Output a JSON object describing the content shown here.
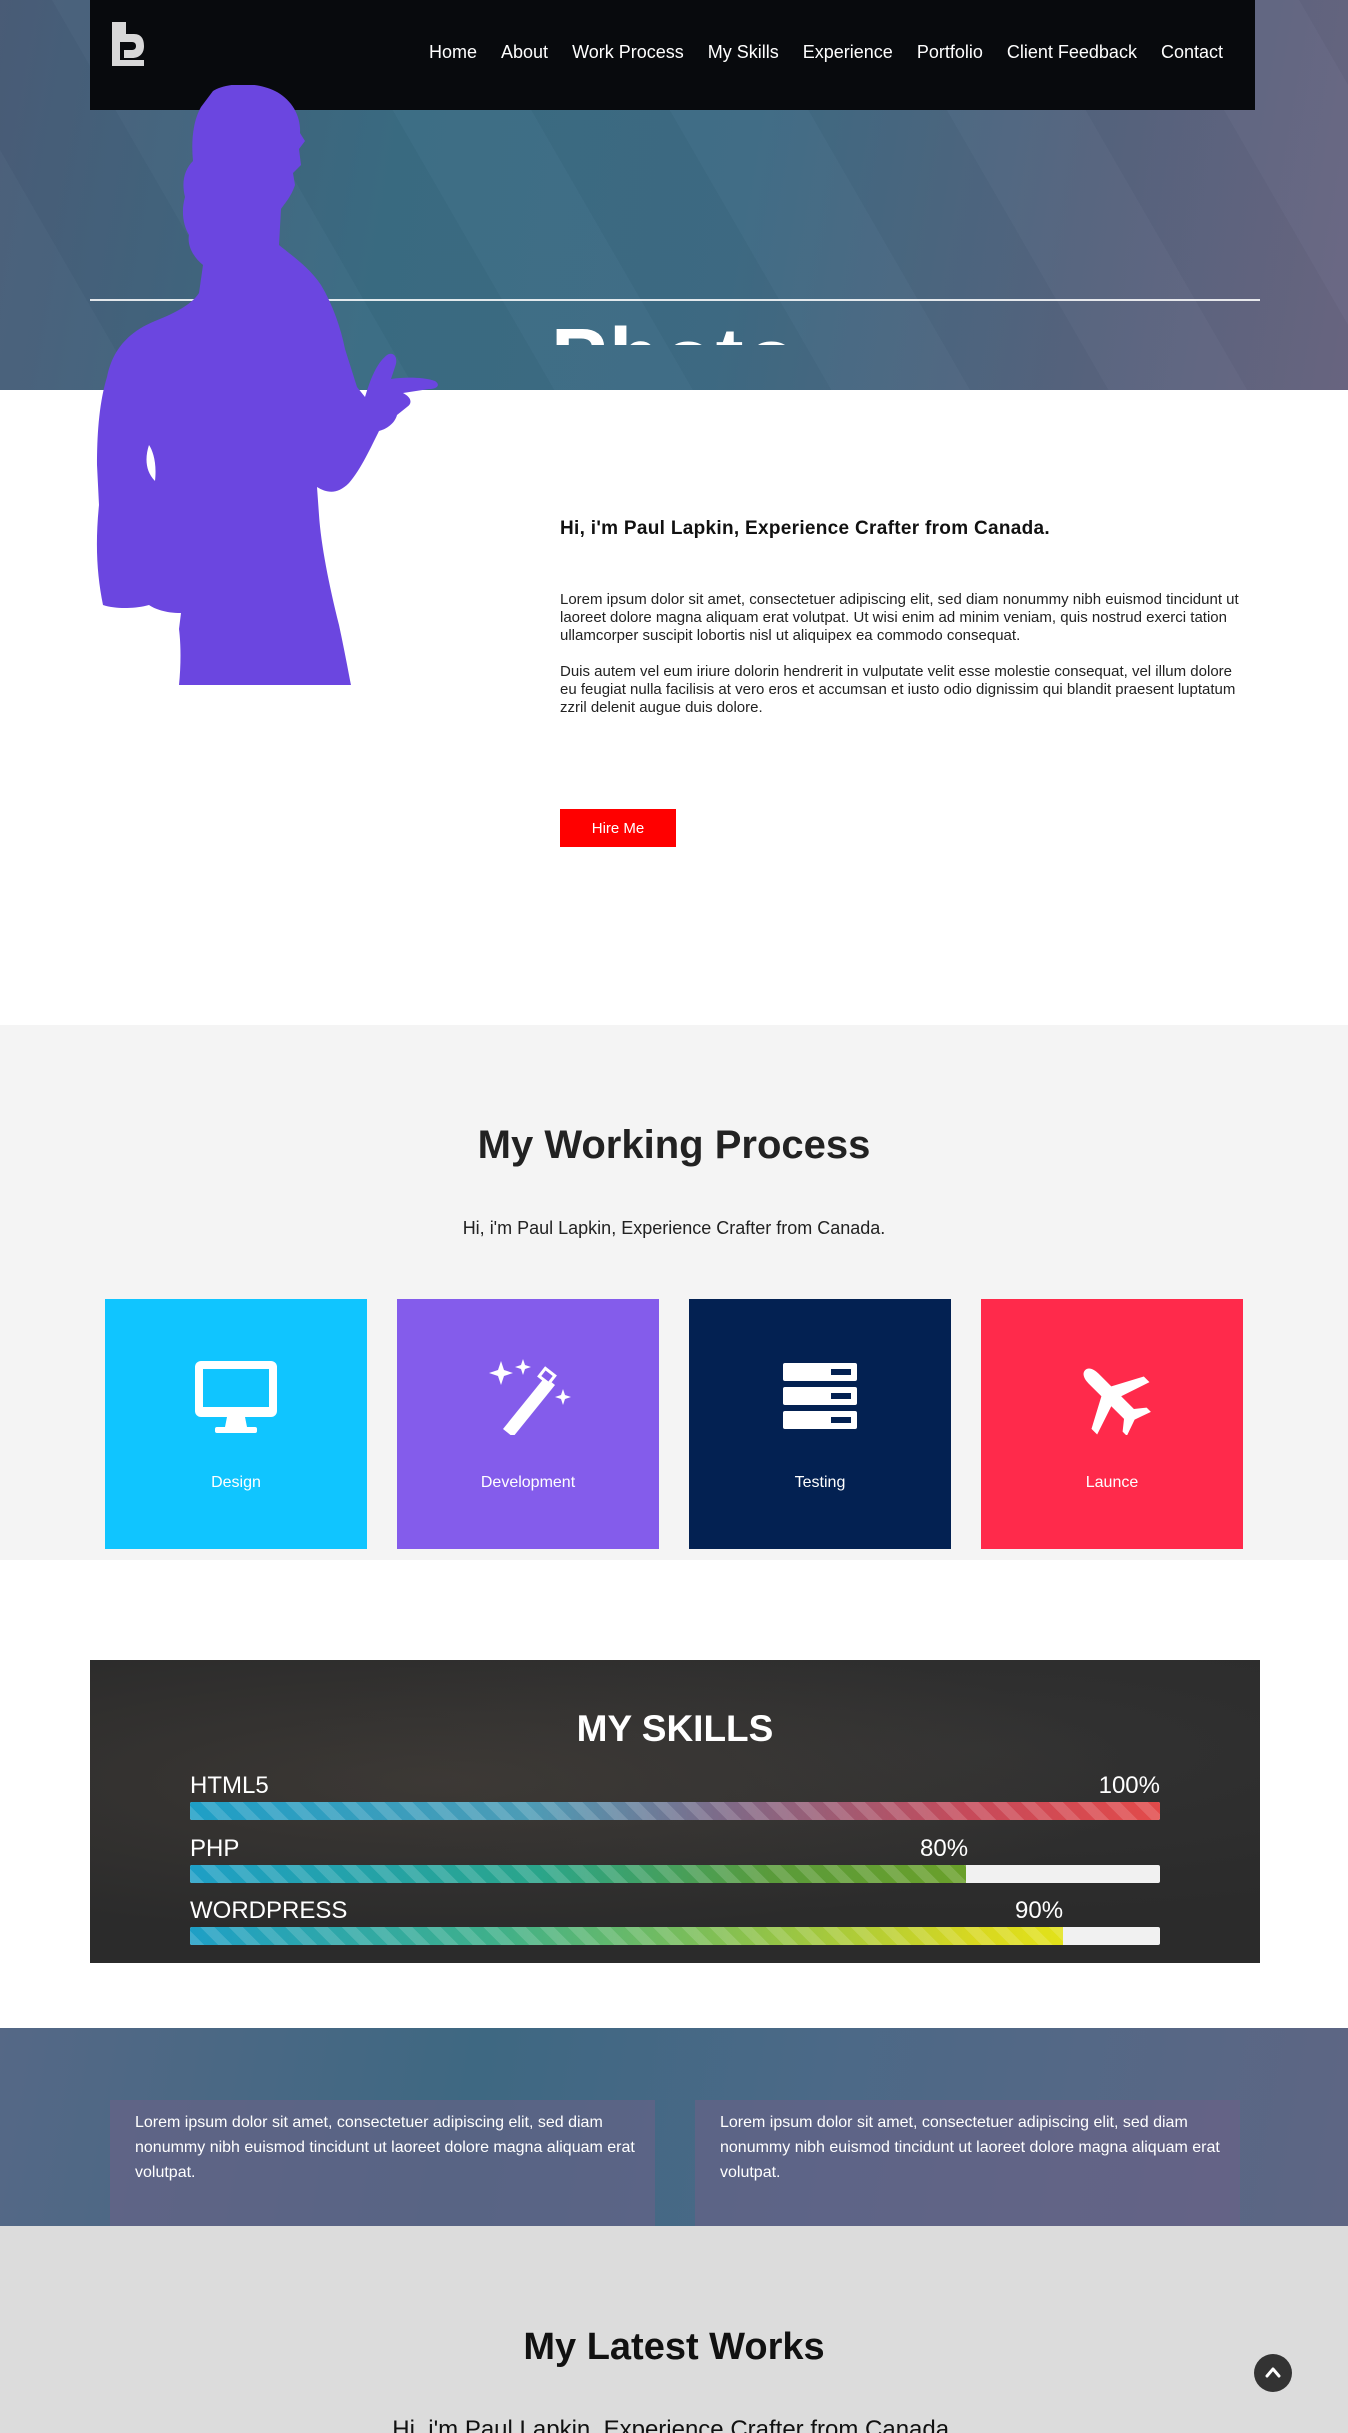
{
  "nav": {
    "logo_icon": "p-logo-icon",
    "items": [
      "Home",
      "About",
      "Work Process",
      "My Skills",
      "Experience",
      "Portfolio",
      "Client Feedback",
      "Contact"
    ]
  },
  "hero": {
    "partial_title": "Photo"
  },
  "about": {
    "title": "Hi, i'm Paul Lapkin, Experience Crafter from Canada.",
    "paragraph1": "Lorem ipsum dolor sit amet, consectetuer adipiscing elit, sed diam nonummy nibh euismod tincidunt ut laoreet dolore magna aliquam erat volutpat. Ut wisi enim ad minim veniam, quis nostrud exerci tation ullamcorper suscipit lobortis nisl ut aliquipex ea commodo consequat.",
    "paragraph2": "Duis autem vel eum iriure dolorin hendrerit in vulputate velit esse molestie consequat, vel illum dolore eu feugiat nulla facilisis at vero eros et accumsan et iusto odio dignissim qui blandit praesent luptatum zzril delenit augue duis dolore.",
    "hire_label": "Hire Me",
    "silhouette_color": "#6b46e0"
  },
  "process": {
    "title": "My Working Process",
    "subtitle": "Hi, i'm Paul Lapkin, Experience Crafter from Canada.",
    "cards": [
      {
        "label": "Design",
        "icon": "monitor-icon",
        "color": "#10c5ff"
      },
      {
        "label": "Development",
        "icon": "magic-wand-icon",
        "color": "#845ceb"
      },
      {
        "label": "Testing",
        "icon": "server-icon",
        "color": "#032152"
      },
      {
        "label": "Launce",
        "icon": "airplane-icon",
        "color": "#ff2a4b"
      }
    ]
  },
  "skills": {
    "title": "MY SKILLS",
    "items": [
      {
        "name": "HTML5",
        "percent": "100%",
        "value": 100
      },
      {
        "name": "PHP",
        "percent": "80%",
        "value": 80
      },
      {
        "name": "WORDPRESS",
        "percent": "90%",
        "value": 90
      }
    ]
  },
  "feedback": {
    "items": [
      "Lorem ipsum dolor sit amet, consectetuer adipiscing elit, sed diam nonummy nibh euismod tincidunt ut laoreet dolore magna aliquam erat volutpat.",
      "Lorem ipsum dolor sit amet, consectetuer adipiscing elit, sed diam nonummy nibh euismod tincidunt ut laoreet dolore magna aliquam erat volutpat."
    ]
  },
  "works": {
    "title": "My Latest Works",
    "subtitle": "Hi, i'm Paul Lapkin, Experience Crafter from Canada."
  },
  "back_to_top_icon": "chevron-up-icon"
}
